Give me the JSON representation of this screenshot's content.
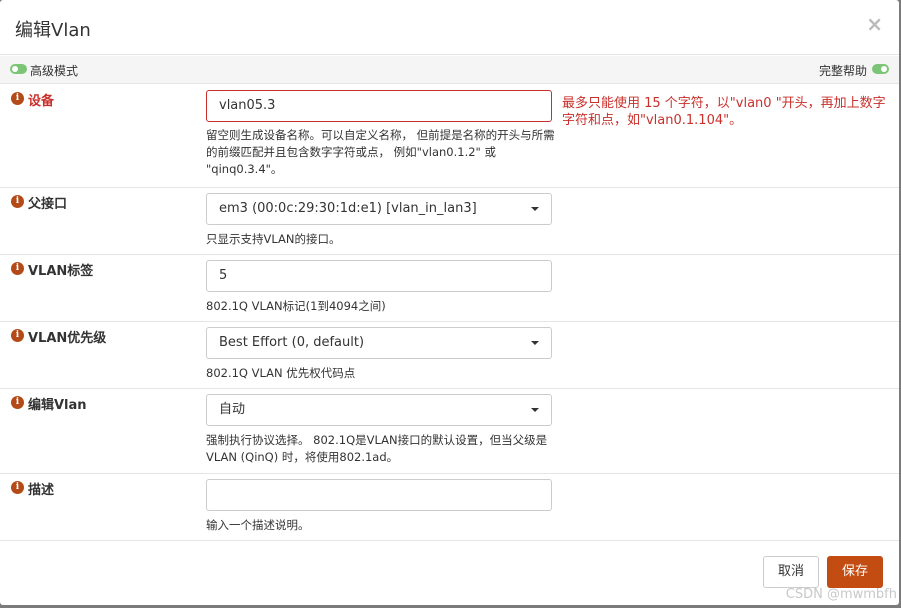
{
  "dialog": {
    "title": "编辑Vlan",
    "close_label": "×"
  },
  "toolbar": {
    "advanced_mode_label": "高级模式",
    "full_help_label": "完整帮助"
  },
  "fields": {
    "device": {
      "label": "设备",
      "value": "vlan05.3",
      "help": "留空则生成设备名称。可以自定义名称， 但前提是名称的开头与所需的前缀匹配并且包含数字字符或点， 例如\"vlan0.1.2\" 或 \"qinq0.3.4\"。",
      "error": "最多只能使用 15 个字符，以\"vlan0 \"开头，再加上数字字符和点，如\"vlan0.1.104\"。"
    },
    "parent_interface": {
      "label": "父接口",
      "value": "em3 (00:0c:29:30:1d:e1) [vlan_in_lan3]",
      "help": "只显示支持VLAN的接口。"
    },
    "vlan_tag": {
      "label": "VLAN标签",
      "value": "5",
      "help": "802.1Q VLAN标记(1到4094之间)"
    },
    "vlan_priority": {
      "label": "VLAN优先级",
      "value": "Best Effort (0, default)",
      "help": "802.1Q VLAN 优先权代码点"
    },
    "vlan_protocol": {
      "label": "编辑Vlan",
      "value": "自动",
      "help": "强制执行协议选择。 802.1Q是VLAN接口的默认设置，但当父级是VLAN (QinQ) 时，将使用802.1ad。"
    },
    "description": {
      "label": "描述",
      "value": "",
      "help": "输入一个描述说明。"
    }
  },
  "footer": {
    "cancel_label": "取消",
    "save_label": "保存"
  },
  "watermark": "CSDN @mwmbfh",
  "colors": {
    "accent": "#c24c12",
    "error": "#c9302c",
    "toggle": "#7cc576"
  }
}
